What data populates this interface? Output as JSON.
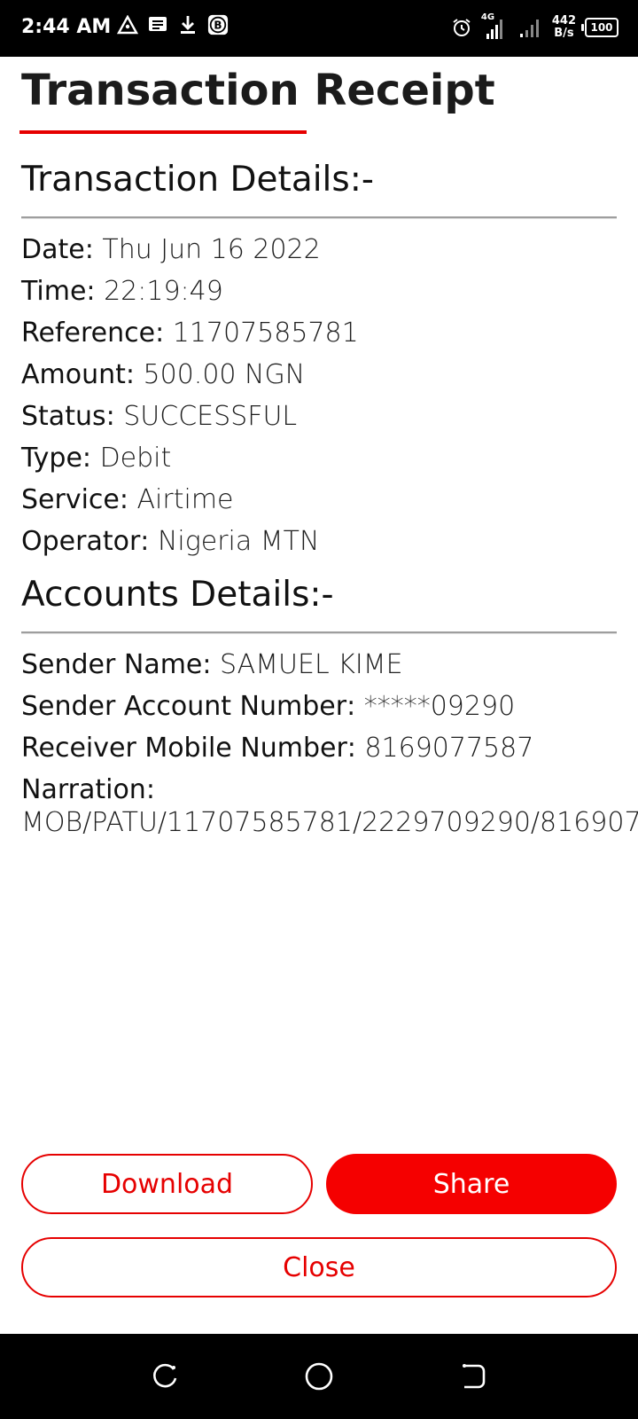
{
  "status_bar": {
    "time": "2:44 AM",
    "network_type": "4G",
    "net_speed_value": "442",
    "net_speed_unit": "B/s",
    "battery": "100"
  },
  "page": {
    "title": "Transaction Receipt"
  },
  "transaction": {
    "heading": "Transaction Details:-",
    "rows": [
      {
        "label": "Date",
        "value": "Thu Jun 16 2022"
      },
      {
        "label": "Time",
        "value": "22:19:49"
      },
      {
        "label": "Reference",
        "value": "11707585781"
      },
      {
        "label": "Amount",
        "value": "500.00 NGN"
      },
      {
        "label": "Status",
        "value": "SUCCESSFUL"
      },
      {
        "label": "Type",
        "value": "Debit"
      },
      {
        "label": "Service",
        "value": "Airtime"
      },
      {
        "label": "Operator",
        "value": "Nigeria MTN"
      }
    ]
  },
  "accounts": {
    "heading": "Accounts Details:-",
    "rows": [
      {
        "label": "Sender Name",
        "value": "SAMUEL KIME"
      },
      {
        "label": "Sender Account Number",
        "value": "*****09290"
      },
      {
        "label": "Receiver Mobile Number",
        "value": "8169077587"
      }
    ],
    "narration_label": "Narration",
    "narration_value": "MOB/PATU/11707585781/2229709290/816907"
  },
  "buttons": {
    "download": "Download",
    "share": "Share",
    "close": "Close"
  },
  "colors": {
    "accent": "#e60000",
    "status_bar": "#000000",
    "background": "#ffffff"
  },
  "icons": {
    "status_left": [
      "triangle-alert-icon",
      "message-icon",
      "download-icon",
      "b-badge-icon"
    ],
    "status_right": [
      "alarm-icon",
      "signal-icon",
      "signal-icon",
      "battery-icon"
    ],
    "nav": [
      "recents-icon",
      "home-icon",
      "back-icon"
    ]
  }
}
